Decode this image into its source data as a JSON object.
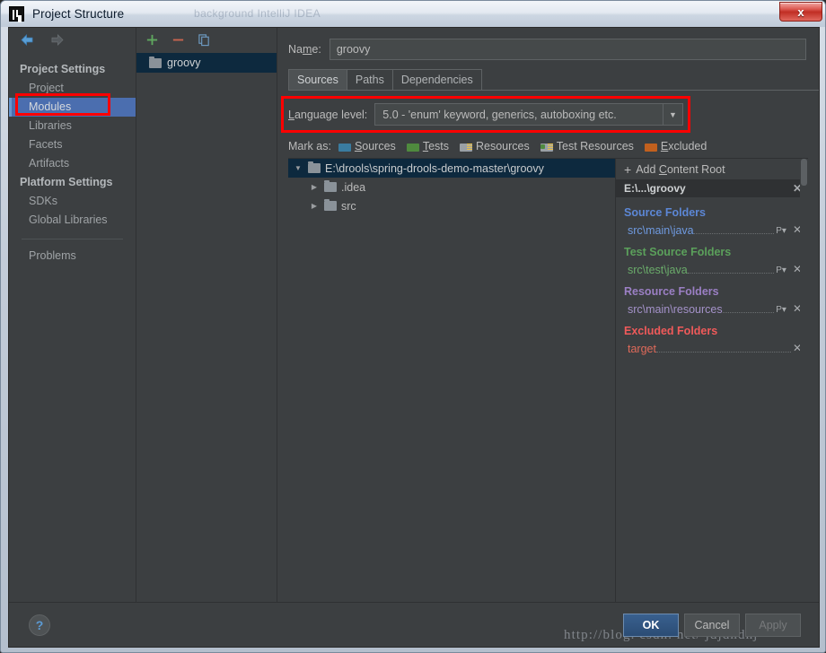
{
  "window": {
    "title": "Project Structure",
    "app_icon": "intellij-idea-logo",
    "close_label": "x",
    "ghost_text": "background IntelliJ IDEA"
  },
  "nav": {
    "back_icon": "arrow-left-icon",
    "forward_icon": "arrow-right-icon"
  },
  "sidebar": {
    "groups": [
      {
        "label": "Project Settings",
        "items": [
          {
            "label": "Project",
            "selected": false
          },
          {
            "label": "Modules",
            "selected": true
          },
          {
            "label": "Libraries",
            "selected": false
          },
          {
            "label": "Facets",
            "selected": false
          },
          {
            "label": "Artifacts",
            "selected": false
          }
        ]
      },
      {
        "label": "Platform Settings",
        "items": [
          {
            "label": "SDKs",
            "selected": false
          },
          {
            "label": "Global Libraries",
            "selected": false
          }
        ]
      }
    ],
    "problems_label": "Problems"
  },
  "modules": {
    "toolbar": {
      "add_icon": "plus-icon",
      "remove_icon": "minus-icon",
      "copy_icon": "copy-icon"
    },
    "list": [
      {
        "label": "groovy",
        "selected": true
      }
    ]
  },
  "main": {
    "name_label": "Name:",
    "name_value": "groovy",
    "name_placeholder": "",
    "tabs": [
      {
        "label": "Sources",
        "active": true
      },
      {
        "label": "Paths",
        "active": false
      },
      {
        "label": "Dependencies",
        "active": false
      }
    ],
    "language_level": {
      "label": "Language level:",
      "value": "5.0 - 'enum' keyword, generics, autoboxing etc.",
      "arrow_icon": "chevron-down-icon"
    },
    "mark_as": {
      "label": "Mark as:",
      "options": [
        {
          "label": "Sources",
          "color": "#3a7ca0"
        },
        {
          "label": "Tests",
          "color": "#4f8a3e"
        },
        {
          "label": "Resources",
          "color": "#9aa0a5"
        },
        {
          "label": "Test Resources",
          "color": "#9aa0a5"
        },
        {
          "label": "Excluded",
          "color": "#c2601e"
        }
      ]
    },
    "tree": [
      {
        "label": "E:\\drools\\spring-drools-demo-master\\groovy",
        "level": 0,
        "expanded": true,
        "selected": true
      },
      {
        "label": ".idea",
        "level": 1,
        "expanded": false,
        "selected": false
      },
      {
        "label": "src",
        "level": 1,
        "expanded": false,
        "selected": false
      }
    ]
  },
  "right_panel": {
    "add_content_root": "Add Content Root",
    "add_icon": "plus-icon",
    "root_header": "E:\\...\\groovy",
    "root_close_icon": "close-icon",
    "categories": [
      {
        "title": "Source Folders",
        "color": "#5c87d6",
        "items": [
          {
            "path": "src\\main\\java",
            "has_package_prefix": true,
            "package_icon": "package-prefix-icon",
            "close_icon": "close-icon"
          }
        ]
      },
      {
        "title": "Test Source Folders",
        "color": "#5ba05b",
        "items": [
          {
            "path": "src\\test\\java",
            "has_package_prefix": true,
            "package_icon": "package-prefix-icon",
            "close_icon": "close-icon"
          }
        ]
      },
      {
        "title": "Resource Folders",
        "color": "#9b7fc4",
        "items": [
          {
            "path": "src\\main\\resources",
            "has_package_prefix": true,
            "package_icon": "package-prefix-icon",
            "close_icon": "close-icon"
          }
        ]
      },
      {
        "title": "Excluded Folders",
        "color": "#f05a5a",
        "items": [
          {
            "path": "target",
            "has_package_prefix": false,
            "package_icon": "",
            "close_icon": "close-icon"
          }
        ]
      }
    ]
  },
  "footer": {
    "help_label": "?",
    "ok_label": "OK",
    "cancel_label": "Cancel",
    "apply_label": "Apply",
    "watermark": "http://blog. csdn. net/ jdjdndhj"
  }
}
